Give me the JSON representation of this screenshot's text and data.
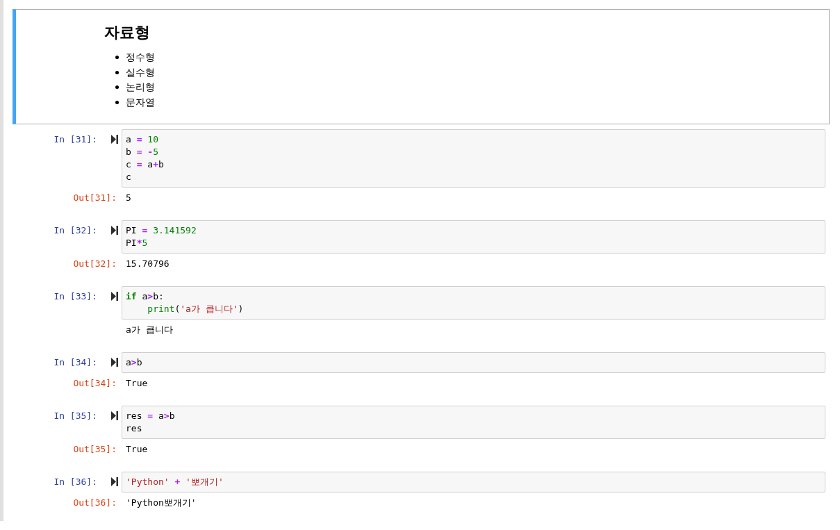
{
  "cells": [
    {
      "kind": "markdown",
      "selected": true,
      "heading": "자료형",
      "items": [
        "정수형",
        "실수형",
        "논리형",
        "문자열"
      ]
    },
    {
      "kind": "code",
      "selected": false,
      "prompt": "In [31]:",
      "lines": [
        [
          {
            "kind": "name",
            "text": "a "
          },
          {
            "kind": "op",
            "text": "="
          },
          {
            "kind": "number",
            "text": " 10"
          }
        ],
        [
          {
            "kind": "name",
            "text": "b "
          },
          {
            "kind": "op",
            "text": "="
          },
          {
            "kind": "op",
            "text": " -"
          },
          {
            "kind": "number",
            "text": "5"
          }
        ],
        [
          {
            "kind": "name",
            "text": "c "
          },
          {
            "kind": "op",
            "text": "="
          },
          {
            "kind": "name",
            "text": " a"
          },
          {
            "kind": "op",
            "text": "+"
          },
          {
            "kind": "name",
            "text": "b"
          }
        ],
        [
          {
            "kind": "name",
            "text": "c"
          }
        ]
      ],
      "output": {
        "prompt": "Out[31]:",
        "text": "5"
      }
    },
    {
      "kind": "code",
      "selected": false,
      "prompt": "In [32]:",
      "lines": [
        [
          {
            "kind": "name",
            "text": "PI "
          },
          {
            "kind": "op",
            "text": "="
          },
          {
            "kind": "number",
            "text": " 3.141592"
          }
        ],
        [
          {
            "kind": "name",
            "text": "PI"
          },
          {
            "kind": "op",
            "text": "*"
          },
          {
            "kind": "number",
            "text": "5"
          }
        ]
      ],
      "output": {
        "prompt": "Out[32]:",
        "text": "15.70796"
      }
    },
    {
      "kind": "code",
      "selected": false,
      "prompt": "In [33]:",
      "lines": [
        [
          {
            "kind": "keyword",
            "text": "if"
          },
          {
            "kind": "name",
            "text": " a"
          },
          {
            "kind": "op",
            "text": ">"
          },
          {
            "kind": "name",
            "text": "b:"
          }
        ],
        [
          {
            "kind": "builtin",
            "text": "    print"
          },
          {
            "kind": "name",
            "text": "("
          },
          {
            "kind": "string",
            "text": "'a가 큽니다'"
          },
          {
            "kind": "name",
            "text": ")"
          }
        ]
      ],
      "output": {
        "text": "a가 큽니다"
      }
    },
    {
      "kind": "code",
      "selected": false,
      "prompt": "In [34]:",
      "lines": [
        [
          {
            "kind": "name",
            "text": "a"
          },
          {
            "kind": "op",
            "text": ">"
          },
          {
            "kind": "name",
            "text": "b"
          }
        ]
      ],
      "output": {
        "prompt": "Out[34]:",
        "text": "True"
      }
    },
    {
      "kind": "code",
      "selected": false,
      "prompt": "In [35]:",
      "lines": [
        [
          {
            "kind": "name",
            "text": "res "
          },
          {
            "kind": "op",
            "text": "="
          },
          {
            "kind": "name",
            "text": " a"
          },
          {
            "kind": "op",
            "text": ">"
          },
          {
            "kind": "name",
            "text": "b"
          }
        ],
        [
          {
            "kind": "name",
            "text": "res"
          }
        ]
      ],
      "output": {
        "prompt": "Out[35]:",
        "text": "True"
      }
    },
    {
      "kind": "code",
      "selected": false,
      "prompt": "In [36]:",
      "lines": [
        [
          {
            "kind": "string",
            "text": "'Python' "
          },
          {
            "kind": "op",
            "text": "+"
          },
          {
            "kind": "string",
            "text": " '뽀개기'"
          }
        ]
      ],
      "output": {
        "prompt": "Out[36]:",
        "text": "'Python뽀개기'"
      }
    }
  ]
}
